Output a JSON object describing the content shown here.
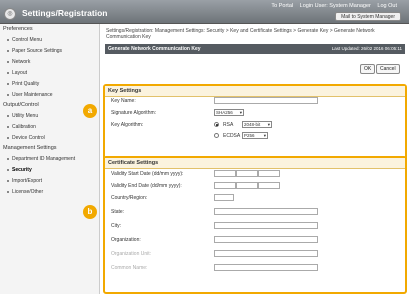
{
  "app": {
    "title": "Settings/Registration",
    "logo_glyph": "◎"
  },
  "top_links": {
    "to_portal": "To Portal",
    "login_user": "Login User: System Manager",
    "log_out": "Log Out"
  },
  "mail_button": "Mail to System Manager",
  "sidebar": {
    "groups": [
      {
        "title": "Preferences",
        "items": [
          "Control Menu",
          "Paper Source Settings",
          "Network",
          "Layout",
          "Print Quality",
          "User Maintenance"
        ]
      },
      {
        "title": "Output/Control",
        "items": [
          "Utility Menu",
          "Calibration",
          "Device Control"
        ]
      },
      {
        "title": "Management Settings",
        "items": [
          "Department ID Management",
          "Security",
          "Import/Export",
          "License/Other"
        ]
      }
    ],
    "active": "Security"
  },
  "breadcrumb": "Settings/Registration: Management Settings: Security > Key and Certificate Settings > Generate Key > Generate Network Communication Key",
  "header": {
    "title": "Generate Network Communication Key",
    "last_updated": "Last Updated: 26/02 2016 06:05:11"
  },
  "buttons": {
    "ok": "OK",
    "cancel": "Cancel"
  },
  "key_settings": {
    "title": "Key Settings",
    "key_name_label": "Key Name:",
    "sig_label": "Signature Algorithm:",
    "sig_value": "SHA256",
    "key_algo_label": "Key Algorithm:",
    "rsa_label": "RSA",
    "rsa_value": "2048-bit",
    "ecdsa_label": "ECDSA",
    "ecdsa_value": "P256"
  },
  "cert_settings": {
    "title": "Certificate Settings",
    "fields": [
      "Validity Start Date (dd/mm yyyy):",
      "Validity End Date (dd/mm yyyy):",
      "Country/Region:",
      "State:",
      "City:",
      "Organization:",
      "Organization Unit:",
      "Common Name:"
    ]
  },
  "badges": {
    "a": "a",
    "b": "b"
  },
  "colors": {
    "accent": "#f2a900",
    "header": "#555b61"
  }
}
